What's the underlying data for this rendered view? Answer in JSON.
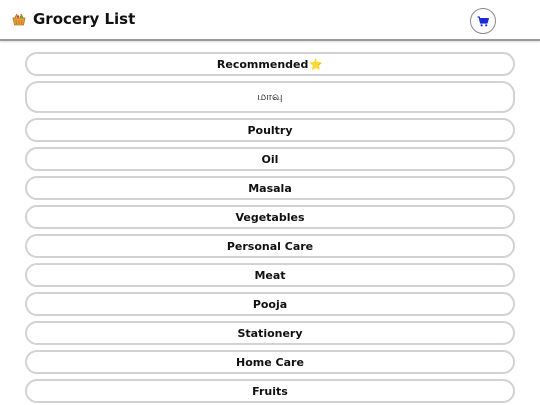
{
  "header": {
    "title": "Grocery List",
    "app_icon": "shopping-basket-icon",
    "cart_icon": "shopping-cart-icon"
  },
  "categories": [
    {
      "label": "Recommended",
      "badge": "⭐"
    },
    {
      "label": "மாவு"
    },
    {
      "label": "Poultry"
    },
    {
      "label": "Oil"
    },
    {
      "label": "Masala"
    },
    {
      "label": "Vegetables"
    },
    {
      "label": "Personal Care"
    },
    {
      "label": "Meat"
    },
    {
      "label": "Pooja"
    },
    {
      "label": "Stationery"
    },
    {
      "label": "Home Care"
    },
    {
      "label": "Fruits"
    }
  ],
  "colors": {
    "cart_icon": "#1a2bd6",
    "star": "#f3c21b",
    "button_border": "#d2d2d2"
  }
}
